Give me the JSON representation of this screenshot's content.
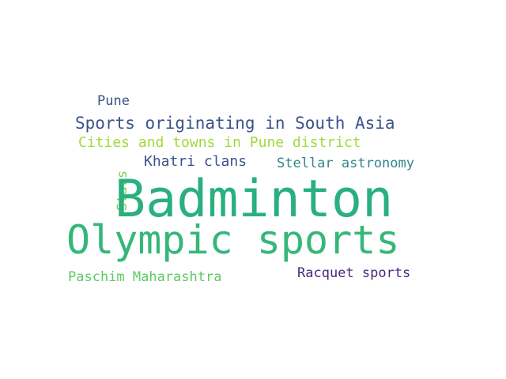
{
  "word_cloud": {
    "words": [
      {
        "text": "Pune",
        "color": "#3b528b"
      },
      {
        "text": "Sports originating in South Asia",
        "color": "#3b528b"
      },
      {
        "text": "Cities and towns in Pune district",
        "color": "#9fda3a"
      },
      {
        "text": "Khatri clans",
        "color": "#3b528b"
      },
      {
        "text": "Stellar astronomy",
        "color": "#31868c"
      },
      {
        "text": "Stars",
        "color": "#7ad151"
      },
      {
        "text": "Badminton",
        "color": "#2ab07f"
      },
      {
        "text": "Olympic sports",
        "color": "#35b779"
      },
      {
        "text": "Paschim Maharashtra",
        "color": "#5ec962"
      },
      {
        "text": "Racquet sports",
        "color": "#482878"
      }
    ]
  }
}
